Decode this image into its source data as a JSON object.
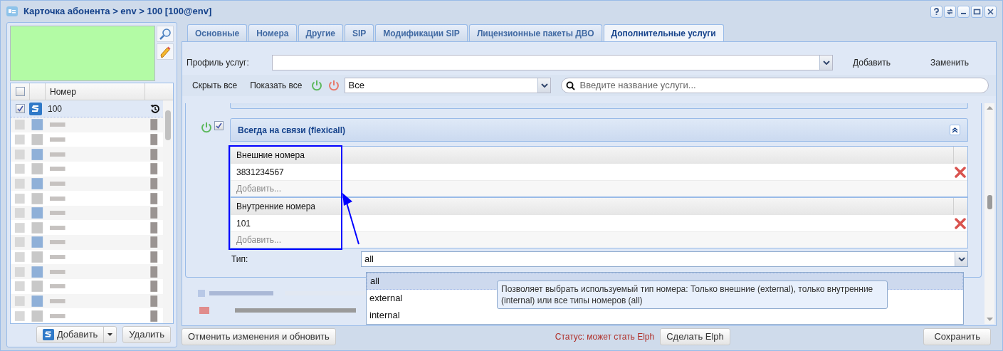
{
  "window": {
    "title": "Карточка абонента > env > 100 [100@env]"
  },
  "left_panel": {
    "grid": {
      "header_checked": false,
      "column": "Номер",
      "rows": [
        {
          "number": "100",
          "checked": true,
          "selected": true
        }
      ]
    },
    "add_button": "Добавить",
    "delete_button": "Удалить"
  },
  "tabs": [
    {
      "label": "Основные",
      "selected": false
    },
    {
      "label": "Номера",
      "selected": false
    },
    {
      "label": "Другие",
      "selected": false
    },
    {
      "label": "SIP",
      "selected": false
    },
    {
      "label": "Модификации SIP",
      "selected": false
    },
    {
      "label": "Лицензионные пакеты ДВО",
      "selected": false
    },
    {
      "label": "Дополнительные услуги",
      "selected": true
    }
  ],
  "profile": {
    "label": "Профиль услуг:",
    "add": "Добавить",
    "replace": "Заменить"
  },
  "toolbar": {
    "hide_all": "Скрыть все",
    "show_all": "Показать все",
    "filter": "Все",
    "search_placeholder": "Введите название услуги..."
  },
  "service": {
    "title": "Всегда на связи (flexicall)",
    "enabled": true,
    "checked": true,
    "expanded": true,
    "groups": [
      {
        "header": "Внешние номера",
        "values": [
          "3831234567"
        ],
        "add_placeholder": "Добавить..."
      },
      {
        "header": "Внутренние номера",
        "values": [
          "101"
        ],
        "add_placeholder": "Добавить..."
      }
    ],
    "type": {
      "label": "Тип:",
      "value": "all",
      "options": [
        {
          "label": "all",
          "selected": true
        },
        {
          "label": "external",
          "selected": false
        },
        {
          "label": "internal",
          "selected": false
        }
      ],
      "tooltip": "Позволяет выбрать используемый тип номера: Только внешние (external), только внутренние (internal) или все типы номеров (all)"
    }
  },
  "footer": {
    "cancel": "Отменить изменения и обновить",
    "status": "Статус: может стать Elph",
    "make_elph": "Сделать Elph",
    "save": "Сохранить"
  }
}
